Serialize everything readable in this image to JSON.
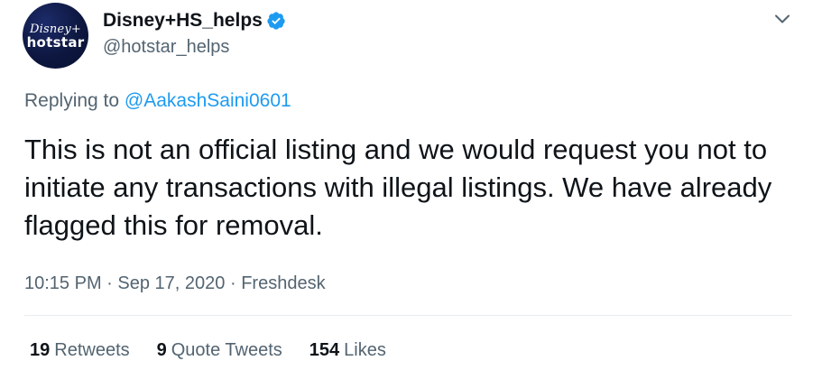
{
  "author": {
    "display_name": "Disney+HS_helps",
    "handle": "@hotstar_helps",
    "verified": true,
    "avatar": {
      "logo_line1": "Disney+",
      "logo_line2": "hotstar",
      "background": "#0d1740"
    }
  },
  "reply": {
    "prefix": "Replying to",
    "mention": "@AakashSaini0601"
  },
  "tweet": {
    "text": "This is not an official listing and we would request you not to initiate any transactions with illegal listings. We have already flagged this for removal."
  },
  "meta": {
    "time": "10:15 PM",
    "separator": "·",
    "date": "Sep 17, 2020",
    "source": "Freshdesk"
  },
  "stats": {
    "retweets": {
      "count": "19",
      "label": "Retweets"
    },
    "quote_tweets": {
      "count": "9",
      "label": "Quote Tweets"
    },
    "likes": {
      "count": "154",
      "label": "Likes"
    }
  },
  "colors": {
    "link": "#1d9bf0",
    "secondary_text": "#536471",
    "primary_text": "#0f1419",
    "verified_badge": "#1d9bf0"
  },
  "icons": {
    "verified": "verified-badge-icon",
    "more": "chevron-down-icon"
  }
}
